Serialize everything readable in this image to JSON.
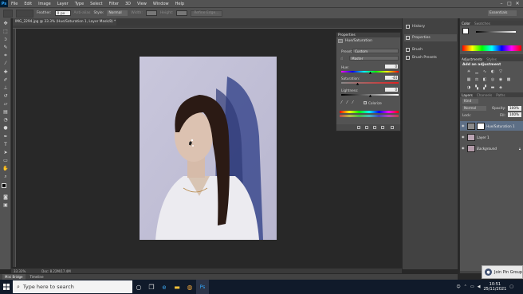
{
  "app": {
    "logo": "Ps"
  },
  "menu": [
    "File",
    "Edit",
    "Image",
    "Layer",
    "Type",
    "Select",
    "Filter",
    "3D",
    "View",
    "Window",
    "Help"
  ],
  "options": {
    "feather_label": "Feather:",
    "feather_value": "0 px",
    "anti_alias": "Anti-alias",
    "style_label": "Style:",
    "style_value": "Normal",
    "width_label": "Width:",
    "height_label": "Height:",
    "refine_edge": "Refine Edge...",
    "workspace": "Essentials"
  },
  "document": {
    "tab_title": "IMG_2294.jpg @ 33.3% (Hue/Saturation 1, Layer Mask/8) *",
    "zoom": "33.33%",
    "doc_info": "Doc: 8.22M/17.4M"
  },
  "bottom_tabs": [
    "Mini Bridge",
    "Timeline"
  ],
  "properties": {
    "title": "Properties",
    "subtitle": "Hue/Saturation",
    "preset_label": "Preset:",
    "preset_value": "Custom",
    "channel_value": "Master",
    "hue_label": "Hue:",
    "hue_value": "0",
    "saturation_label": "Saturation:",
    "saturation_value": "-44",
    "lightness_label": "Lightness:",
    "lightness_value": "0",
    "colorize_label": "Colorize",
    "hue_level": 0.5,
    "saturation_level": 0.28,
    "lightness_level": 0.5
  },
  "strip": {
    "history": "History",
    "properties": "Properties",
    "brush": "Brush",
    "brush_presets": "Brush Presets"
  },
  "color_panel": {
    "tab_color": "Color",
    "tab_swatches": "Swatches"
  },
  "adjustments": {
    "tab_adjustments": "Adjustments",
    "tab_styles": "Styles",
    "heading": "Add an adjustment"
  },
  "layers": {
    "tab_layers": "Layers",
    "tab_channels": "Channels",
    "tab_paths": "Paths",
    "kind_label": "Kind",
    "blend_mode": "Normal",
    "opacity_label": "Opacity:",
    "opacity_value": "100%",
    "lock_label": "Lock:",
    "fill_label": "Fill:",
    "fill_value": "100%",
    "items": [
      {
        "name": "Hue/Saturation 1",
        "selected": true
      },
      {
        "name": "Layer 1",
        "selected": false
      },
      {
        "name": "Background",
        "selected": false
      }
    ]
  },
  "taskbar": {
    "search_placeholder": "Type here to search",
    "time": "10:51",
    "date": "25/11/2021"
  },
  "notification": {
    "text": "Join Pin Group"
  },
  "colors": {
    "accent_selected_layer": "#5d6f86",
    "taskbar": "#101a2a"
  }
}
